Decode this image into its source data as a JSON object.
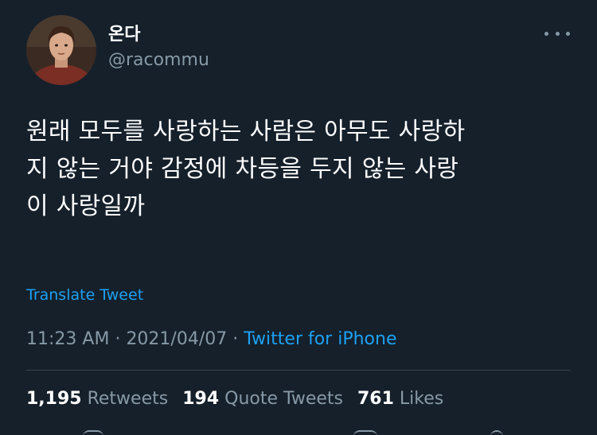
{
  "user": {
    "display_name": "온다",
    "handle": "@racommu"
  },
  "tweet": {
    "text": "원래 모두를 사랑하는 사람은 아무도 사랑하\n지 않는 거야 감정에 차등을 두지 않는 사랑\n이 사랑일까",
    "translate_label": "Translate Tweet",
    "time": "11:23 AM",
    "date": "2021/04/07",
    "separator": "·",
    "source": "Twitter for iPhone"
  },
  "stats": {
    "retweets_count": "1,195",
    "retweets_label": "Retweets",
    "quote_count": "194",
    "quote_label": "Quote Tweets",
    "likes_count": "761",
    "likes_label": "Likes"
  },
  "icons": {
    "more": "more-icon"
  },
  "colors": {
    "background": "#15202b",
    "text_primary": "#ffffff",
    "text_secondary": "#8899a6",
    "link": "#1da1f2",
    "divider": "#38444d"
  }
}
